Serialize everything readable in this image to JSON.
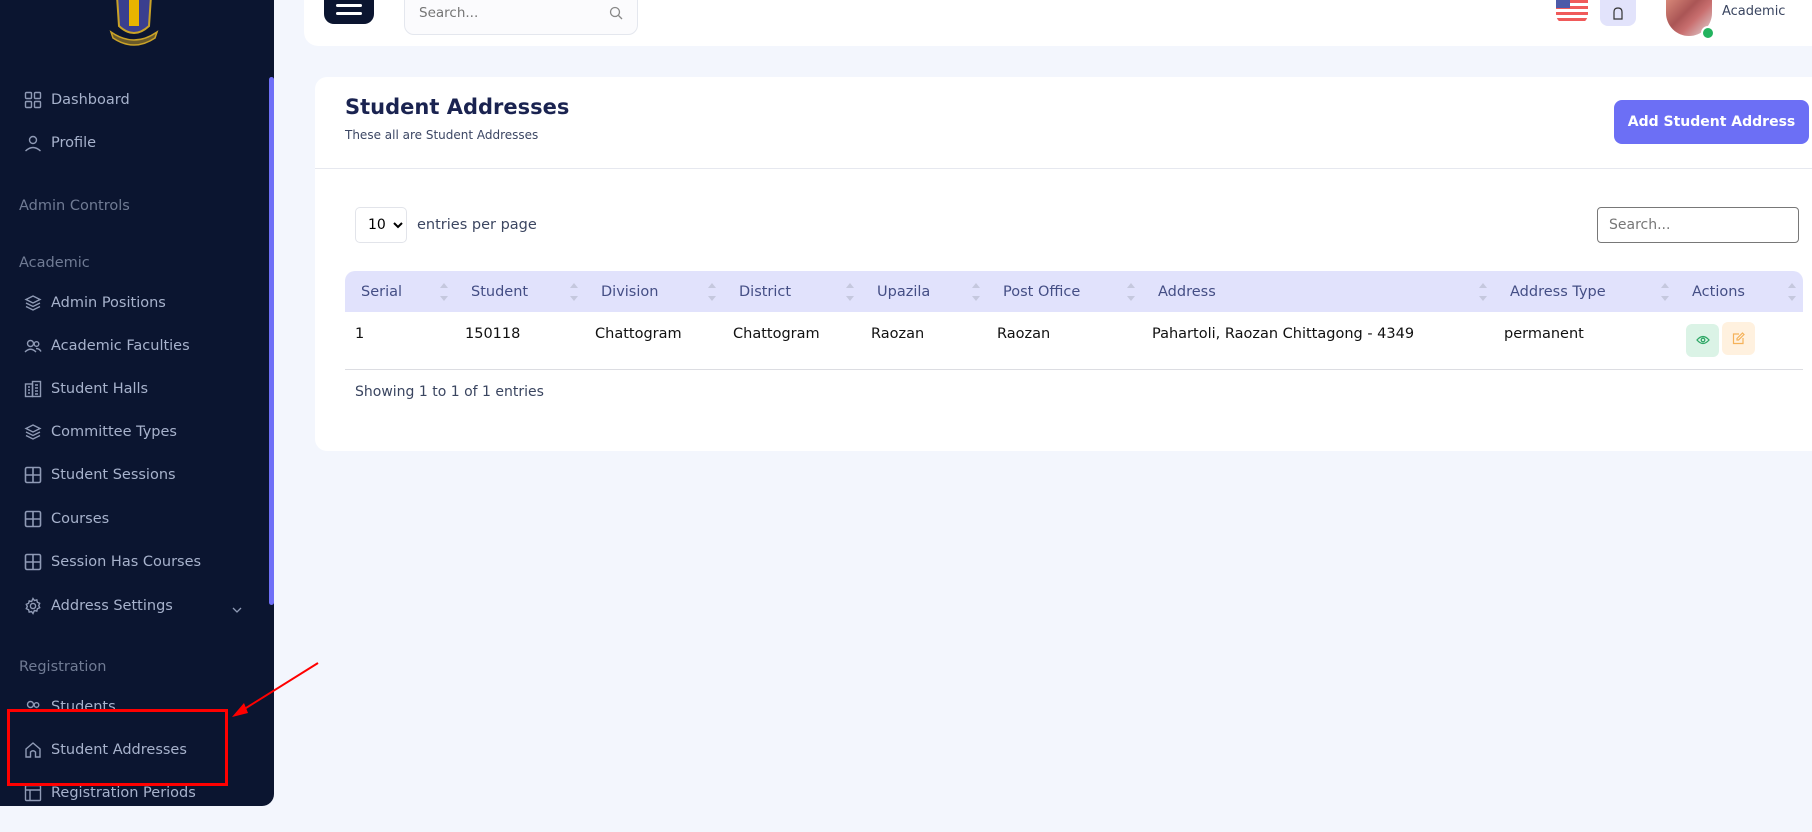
{
  "sidebar": {
    "items": [
      {
        "label": "Dashboard",
        "icon": "grid-icon"
      },
      {
        "label": "Profile",
        "icon": "user-icon"
      }
    ],
    "sections": {
      "admin_controls": "Admin Controls",
      "academic": "Academic",
      "registration": "Registration"
    },
    "academic_items": [
      {
        "label": "Admin Positions",
        "icon": "layers-icon"
      },
      {
        "label": "Academic Faculties",
        "icon": "users-icon"
      },
      {
        "label": "Student Halls",
        "icon": "building-icon"
      },
      {
        "label": "Committee Types",
        "icon": "layers-icon"
      },
      {
        "label": "Student Sessions",
        "icon": "table-icon"
      },
      {
        "label": "Courses",
        "icon": "table-icon"
      },
      {
        "label": "Session Has Courses",
        "icon": "table-icon"
      },
      {
        "label": "Address Settings",
        "icon": "gear-icon"
      }
    ],
    "registration_items": [
      {
        "label": "Students",
        "icon": "users-icon"
      },
      {
        "label": "Student Addresses",
        "icon": "home-icon"
      },
      {
        "label": "Registration Periods",
        "icon": "layout-icon"
      }
    ]
  },
  "topbar": {
    "search_placeholder": "Search...",
    "user_role": "Academic"
  },
  "page": {
    "title": "Student Addresses",
    "subtitle": "These all are Student Addresses",
    "add_button": "Add Student Address"
  },
  "table": {
    "per_page_value": "10",
    "per_page_label": "entries per page",
    "search_placeholder": "Search...",
    "columns": [
      "Serial",
      "Student",
      "Division",
      "District",
      "Upazila",
      "Post Office",
      "Address",
      "Address Type",
      "Actions"
    ],
    "rows": [
      {
        "serial": "1",
        "student": "150118",
        "division": "Chattogram",
        "district": "Chattogram",
        "upazila": "Raozan",
        "post_office": "Raozan",
        "address": "Pahartoli, Raozan Chittagong - 4349",
        "address_type": "permanent"
      }
    ],
    "footer": "Showing 1 to 1 of 1 entries"
  },
  "colors": {
    "sidebar_bg": "#0b1530",
    "accent": "#6c6ff5",
    "table_header_bg": "#e1e2fc",
    "view_btn_bg": "#dbf3e6",
    "edit_btn_bg": "#fff1df",
    "annotation": "#ff0000"
  }
}
